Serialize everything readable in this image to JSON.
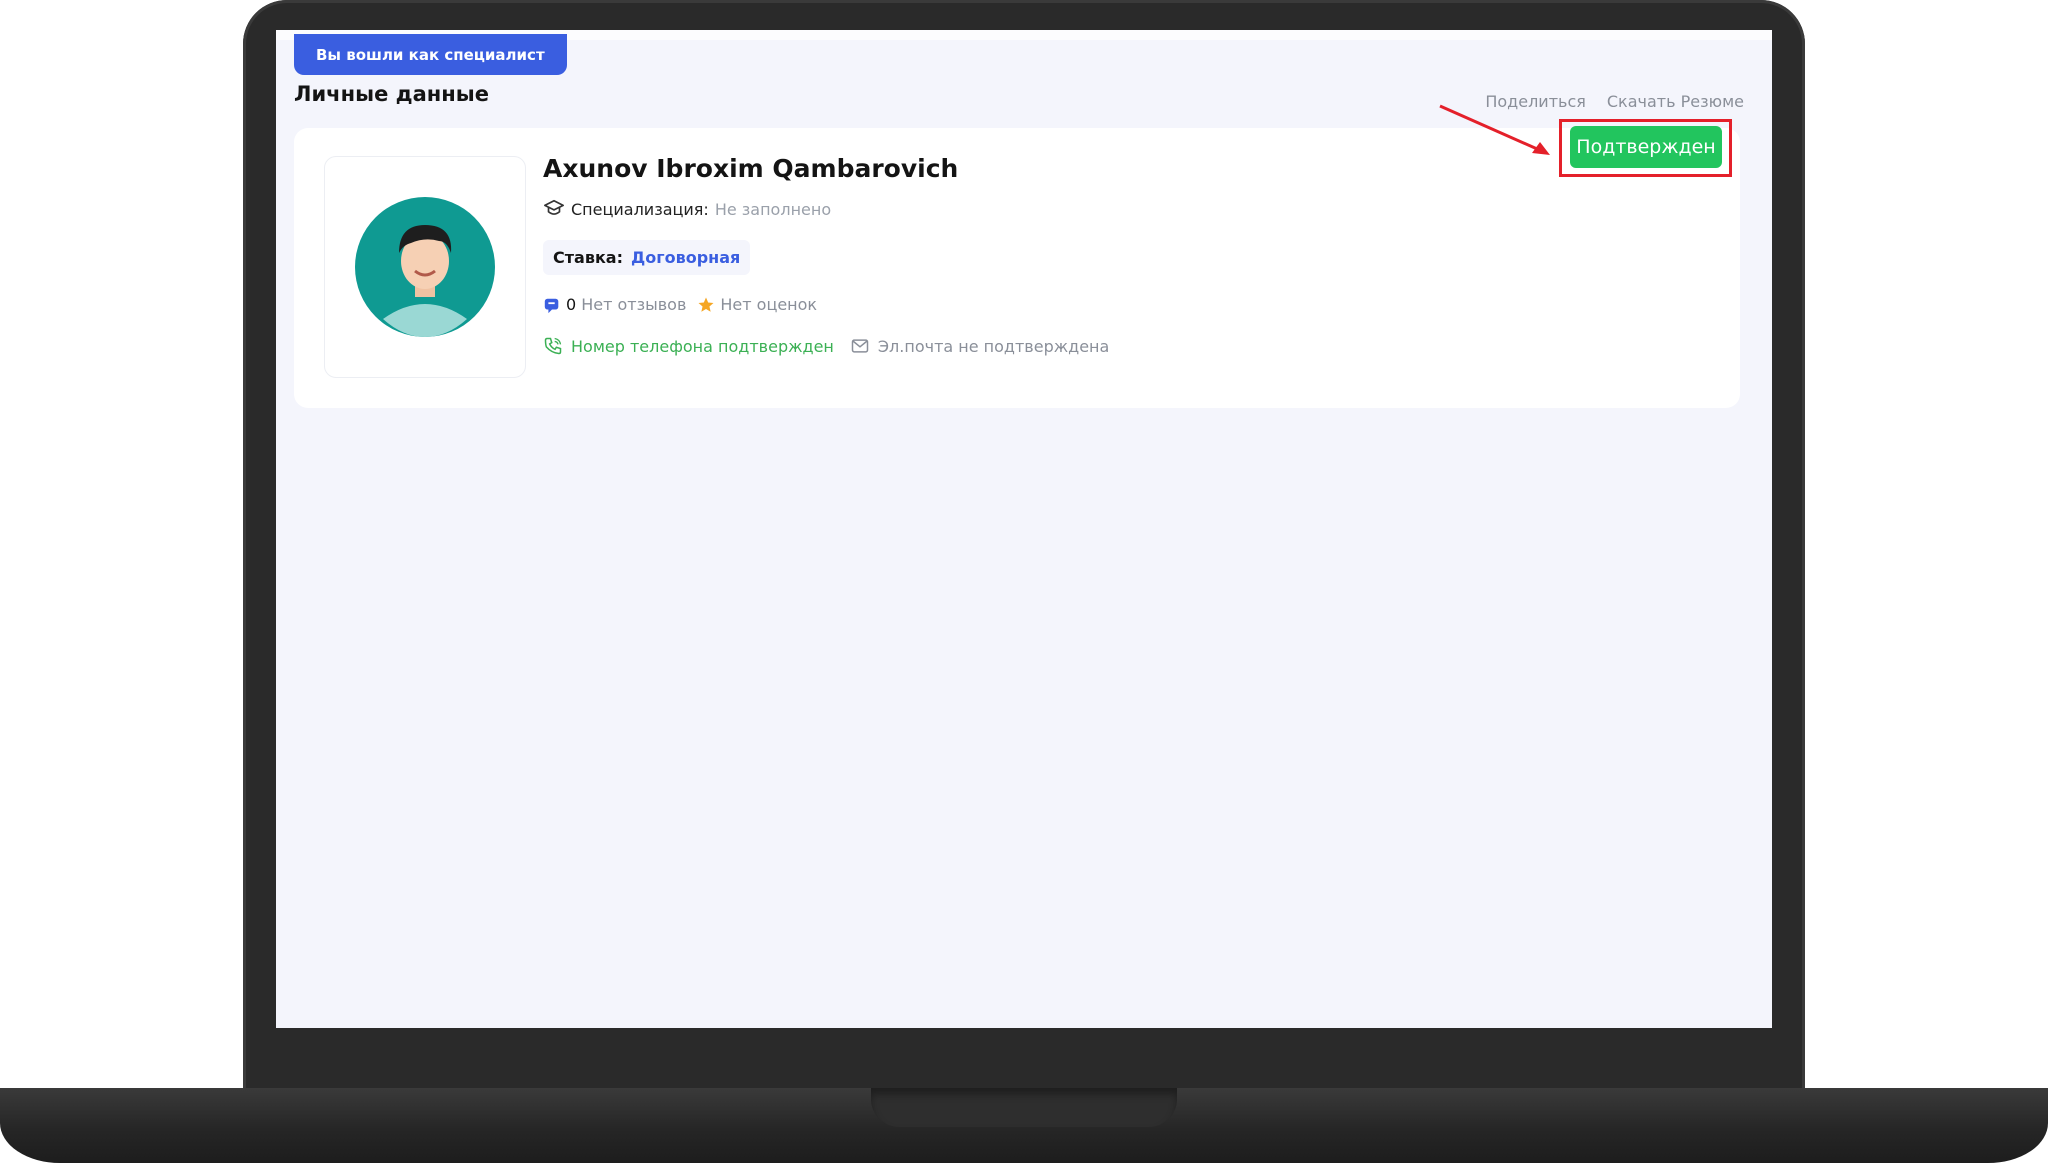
{
  "badge": {
    "label": "Вы вошли как специалист"
  },
  "section": {
    "title": "Личные данные"
  },
  "actions": {
    "share": "Поделиться",
    "download": "Скачать Резюме"
  },
  "profile": {
    "name": "Axunov Ibroxim Qambarovich",
    "specialization_label": "Специализация:",
    "specialization_value": "Не заполнено",
    "rate_label": "Ставка:",
    "rate_value": "Договорная",
    "reviews_count": "0",
    "reviews_text": "Нет отзывов",
    "ratings_text": "Нет оценок",
    "phone_status": "Номер телефона подтвержден",
    "email_status": "Эл.почта не подтверждена",
    "status_button": "Подтвержден"
  },
  "colors": {
    "accent": "#3a5ee0",
    "confirm": "#22c55e",
    "highlight": "#e4202a",
    "phone_ok": "#3bb054"
  },
  "icons": [
    "graduation-cap-icon",
    "reviews-icon",
    "star-icon",
    "phone-icon",
    "mail-icon",
    "red-arrow-icon"
  ]
}
